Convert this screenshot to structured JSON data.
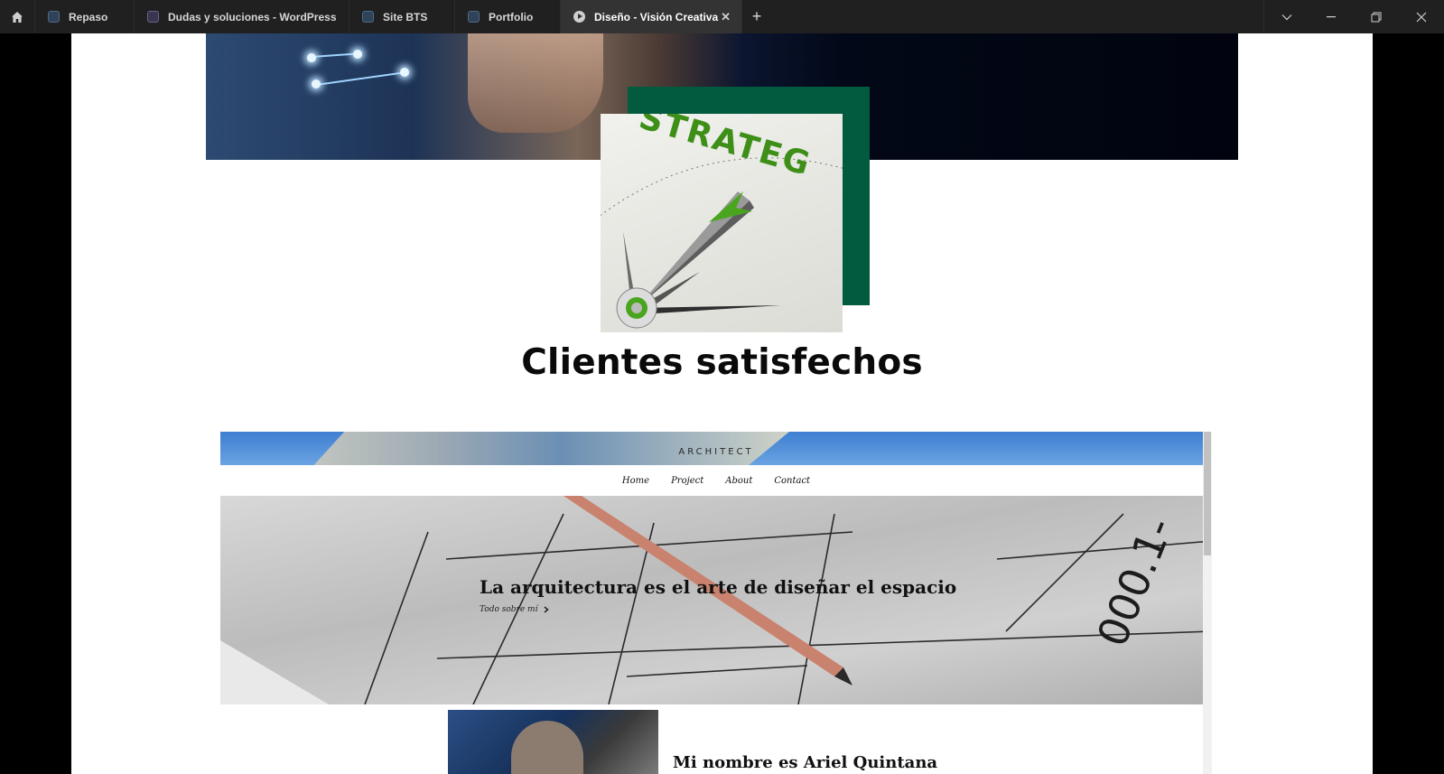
{
  "browser": {
    "tabs": [
      {
        "label": "Repaso"
      },
      {
        "label": "Dudas y soluciones - WordPress"
      },
      {
        "label": "Site BTS"
      },
      {
        "label": "Portfolio"
      },
      {
        "label": "Diseño - Visión Creativa",
        "active": true
      }
    ],
    "close_glyph": "✕",
    "new_tab_glyph": "+"
  },
  "hero": {
    "strategy_image_text": "STRATEG"
  },
  "section": {
    "heading": "Clientes satisfechos"
  },
  "preview": {
    "brand": "ARCHITECT",
    "nav": [
      "Home",
      "Project",
      "About",
      "Contact"
    ],
    "hero_title": "La arquitectura es el arte de diseñar el espacio",
    "hero_link": "Todo sobre mí",
    "blueprint_number": "000.1-",
    "about_title": "Mi nombre es Ariel Quintana"
  },
  "colors": {
    "tabbar": "#202020",
    "active_tab": "#333333",
    "green_accent": "#025a3f",
    "heading": "#0a0a0a"
  }
}
